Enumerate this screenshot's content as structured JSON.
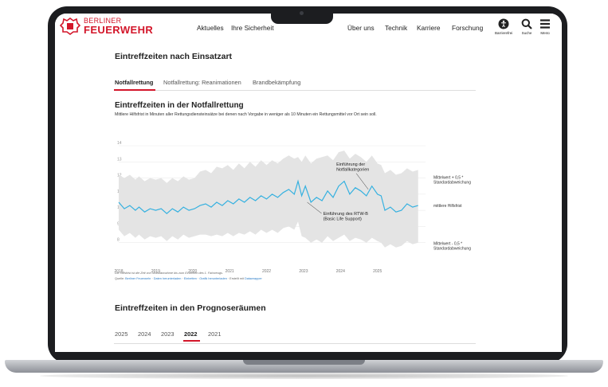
{
  "header": {
    "logo_line1": "BERLINER",
    "logo_line2": "FEUERWEHR",
    "nav_left": [
      "Aktuelles",
      "Ihre Sicherheit"
    ],
    "nav_right": [
      "Über uns",
      "Technik",
      "Karriere",
      "Forschung"
    ],
    "icons": [
      {
        "name": "accessibility-icon",
        "label": "Barrierefrei"
      },
      {
        "name": "search-icon",
        "label": "Suche"
      },
      {
        "name": "menu-icon",
        "label": "Menü"
      }
    ]
  },
  "section_title": "Eintreffzeiten nach Einsatzart",
  "tabs": [
    {
      "label": "Notfallrettung",
      "active": true
    },
    {
      "label": "Notfallrettung: Reanimationen",
      "active": false
    },
    {
      "label": "Brandbekämpfung",
      "active": false
    }
  ],
  "chart_heading": "Eintreffzeiten in der Notfallrettung",
  "chart_subheading": "Mittlere Hilfsfrist in Minuten aller Rettungsdiensteinsätze bei denen nach Vorgabe in weniger als 10 Minuten ein Rettungsmittel vor Ort sein soll.",
  "chart_data": {
    "type": "line",
    "ylim": [
      7,
      14
    ],
    "yticks": [
      "8",
      "9",
      "10",
      "11",
      "12",
      "13",
      "14"
    ],
    "xlim": [
      2018,
      2026.3
    ],
    "xticks": [
      "2018",
      "2019",
      "2020",
      "2021",
      "2022",
      "2023",
      "2024",
      "2025"
    ],
    "grid": true,
    "series": [
      {
        "name": "mittlere Hilfsfrist",
        "color": "#36b1e0",
        "x": [
          2018.0,
          2018.15,
          2018.3,
          2018.45,
          2018.55,
          2018.7,
          2018.85,
          2019.0,
          2019.15,
          2019.3,
          2019.45,
          2019.6,
          2019.75,
          2019.9,
          2020.05,
          2020.2,
          2020.35,
          2020.5,
          2020.65,
          2020.8,
          2020.95,
          2021.1,
          2021.25,
          2021.4,
          2021.55,
          2021.7,
          2021.85,
          2022.0,
          2022.15,
          2022.3,
          2022.45,
          2022.6,
          2022.75,
          2022.85,
          2022.95,
          2023.05,
          2023.2,
          2023.35,
          2023.5,
          2023.65,
          2023.8,
          2023.95,
          2024.1,
          2024.25,
          2024.4,
          2024.55,
          2024.7,
          2024.85,
          2025.0,
          2025.1,
          2025.2,
          2025.35,
          2025.5,
          2025.65,
          2025.8,
          2025.95,
          2026.1
        ],
        "values": [
          10.5,
          10.1,
          10.3,
          10.0,
          10.2,
          9.9,
          10.1,
          10.0,
          10.1,
          9.8,
          10.1,
          9.9,
          10.2,
          10.0,
          10.1,
          10.3,
          10.4,
          10.2,
          10.5,
          10.3,
          10.6,
          10.4,
          10.7,
          10.5,
          10.8,
          10.6,
          10.9,
          10.7,
          11.0,
          10.8,
          11.1,
          11.3,
          11.0,
          11.8,
          10.9,
          11.5,
          10.5,
          10.8,
          10.6,
          11.2,
          10.8,
          11.5,
          11.8,
          11.0,
          11.4,
          11.2,
          10.9,
          11.5,
          11.0,
          10.9,
          10.0,
          10.2,
          9.9,
          10.0,
          10.4,
          10.2,
          10.3
        ]
      }
    ],
    "band": {
      "upper": [
        12.2,
        12.0,
        12.2,
        11.9,
        12.1,
        11.8,
        12.0,
        11.9,
        12.0,
        11.7,
        12.0,
        11.8,
        12.1,
        11.9,
        12.0,
        12.4,
        12.5,
        12.3,
        12.7,
        12.6,
        12.8,
        12.5,
        12.9,
        12.6,
        13.0,
        12.7,
        13.1,
        12.8,
        13.1,
        12.9,
        13.2,
        13.4,
        13.2,
        13.3,
        13.0,
        13.4,
        12.9,
        13.2,
        13.3,
        13.4,
        13.1,
        13.6,
        13.7,
        13.2,
        13.5,
        13.3,
        13.0,
        13.4,
        12.9,
        12.8,
        12.3,
        12.5,
        12.2,
        12.3,
        12.6,
        12.4,
        12.5
      ],
      "lower": [
        8.8,
        8.4,
        8.6,
        8.3,
        8.5,
        8.2,
        8.4,
        8.3,
        8.4,
        8.1,
        8.4,
        8.2,
        8.5,
        8.3,
        8.4,
        8.5,
        8.5,
        8.4,
        8.5,
        8.4,
        8.6,
        8.4,
        8.6,
        8.5,
        8.7,
        8.5,
        8.8,
        8.6,
        8.8,
        8.6,
        8.9,
        9.0,
        8.8,
        9.3,
        8.4,
        8.3,
        8.0,
        8.2,
        8.0,
        8.4,
        8.1,
        8.3,
        8.5,
        8.1,
        8.3,
        8.2,
        8.0,
        8.3,
        8.1,
        8.0,
        7.7,
        7.9,
        7.7,
        7.8,
        8.1,
        7.9,
        8.0
      ]
    },
    "labels": {
      "upper": "Mittelwert + 0,5 * Standardabweichung",
      "mean": "mittlere Hilfsfrist",
      "lower": "Mittelwert - 0,5 * Standardabweichung"
    },
    "annotations": [
      {
        "text": "Einführung der Notfallkategorien",
        "x": 2024.75,
        "y": 11.3
      },
      {
        "text": "Einführung des RTW-B (Basic Life Support)",
        "x": 2023.1,
        "y": 10.5
      }
    ]
  },
  "note": "Die Hilfsfrist ist die Zeit von Notrufannahme bis zum Eintreffen des 1. Fahrzeugs.",
  "source": {
    "prefix": "Quelle: ",
    "parts": [
      "Berliner Feuerwehr",
      " · ",
      "Daten herunterladen",
      " · ",
      "Einbetten",
      " · ",
      "Grafik herunterladen",
      " · Erstellt mit ",
      "Datawrapper"
    ]
  },
  "section_title_2": "Eintreffzeiten in den Prognoseräumen",
  "years": [
    {
      "label": "2025",
      "active": false
    },
    {
      "label": "2024",
      "active": false
    },
    {
      "label": "2023",
      "active": false
    },
    {
      "label": "2022",
      "active": true
    },
    {
      "label": "2021",
      "active": false
    }
  ]
}
